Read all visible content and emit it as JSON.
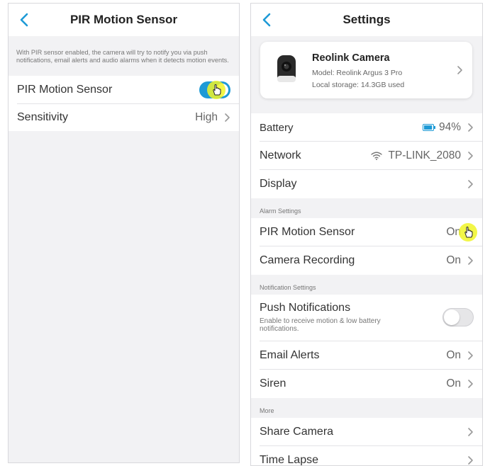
{
  "left": {
    "title": "PIR Motion Sensor",
    "description": "With PIR sensor enabled, the camera will try to notify you via push notifications, email alerts and audio alarms when it detects motion events.",
    "rows": [
      {
        "label": "PIR Motion Sensor",
        "toggle": "on"
      },
      {
        "label": "Sensitivity",
        "value": "High"
      }
    ]
  },
  "right": {
    "title": "Settings",
    "camera": {
      "name": "Reolink Camera",
      "model": "Model: Reolink Argus 3 Pro",
      "storage": "Local storage: 14.3GB used"
    },
    "battery": {
      "label": "Battery",
      "value": "94%",
      "level": 0.94
    },
    "network": {
      "label": "Network",
      "value": "TP-LINK_2080"
    },
    "display": {
      "label": "Display"
    },
    "alarm_section": "Alarm Settings",
    "pir": {
      "label": "PIR Motion Sensor",
      "value": "On"
    },
    "recording": {
      "label": "Camera Recording",
      "value": "On"
    },
    "notification_section": "Notification Settings",
    "push": {
      "label": "Push Notifications",
      "sub": "Enable to receive motion & low battery notifications.",
      "toggle": "off"
    },
    "email": {
      "label": "Email Alerts",
      "value": "On"
    },
    "siren": {
      "label": "Siren",
      "value": "On"
    },
    "more_section": "More",
    "share": {
      "label": "Share Camera"
    },
    "timelapse": {
      "label": "Time Lapse"
    }
  },
  "icons": {
    "back": "chevron-left-icon",
    "chevron": "chevron-right-icon",
    "battery": "battery-icon",
    "wifi": "wifi-icon",
    "cursor": "hand-pointer-icon"
  },
  "colors": {
    "accent": "#1e9ad6",
    "highlight": "#f0f528",
    "background": "#f2f2f4"
  }
}
